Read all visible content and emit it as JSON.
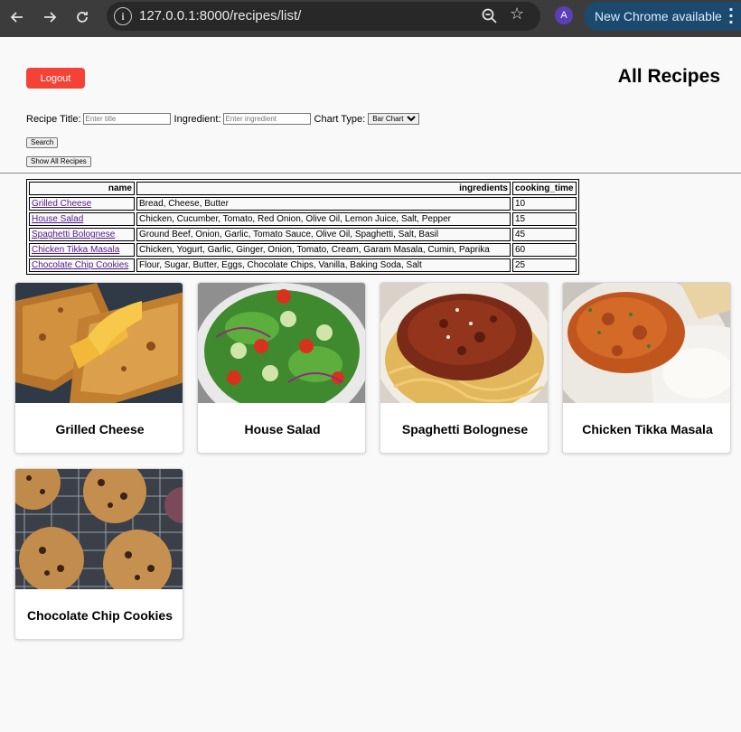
{
  "browser": {
    "url": "127.0.0.1:8000/recipes/list/",
    "profile_initial": "A",
    "update_label": "New Chrome available",
    "icons": [
      "back-arrow-icon",
      "forward-arrow-icon",
      "reload-icon",
      "site-info-icon",
      "zoom-icon",
      "bookmark-star-icon",
      "more-vert-icon"
    ]
  },
  "header": {
    "logout_label": "Logout",
    "title": "All Recipes"
  },
  "search": {
    "title_label": "Recipe Title:",
    "title_placeholder": "Enter title",
    "ingredient_label": "Ingredient:",
    "ingredient_placeholder": "Enter ingredient",
    "chart_label": "Chart Type:",
    "chart_selected": "Bar Chart",
    "search_label": "Search",
    "show_all_label": "Show All Recipes"
  },
  "table": {
    "columns": [
      "name",
      "ingredients",
      "cooking_time"
    ],
    "rows": [
      {
        "name": "Grilled Cheese",
        "ingredients": "Bread, Cheese, Butter",
        "cooking_time": "10"
      },
      {
        "name": "House Salad",
        "ingredients": "Chicken, Cucumber, Tomato, Red Onion, Olive Oil, Lemon Juice, Salt, Pepper",
        "cooking_time": "15"
      },
      {
        "name": "Spaghetti Bolognese",
        "ingredients": "Ground Beef, Onion, Garlic, Tomato Sauce, Olive Oil, Spaghetti, Salt, Basil",
        "cooking_time": "45"
      },
      {
        "name": "Chicken Tikka Masala",
        "ingredients": "Chicken, Yogurt, Garlic, Ginger, Onion, Tomato, Cream, Garam Masala, Cumin, Paprika",
        "cooking_time": "60"
      },
      {
        "name": "Chocolate Chip Cookies",
        "ingredients": "Flour, Sugar, Butter, Eggs, Chocolate Chips, Vanilla, Baking Soda, Salt",
        "cooking_time": "25"
      }
    ]
  },
  "cards": [
    {
      "title": "Grilled Cheese"
    },
    {
      "title": "House Salad"
    },
    {
      "title": "Spaghetti Bolognese"
    },
    {
      "title": "Chicken Tikka Masala"
    },
    {
      "title": "Chocolate Chip Cookies"
    }
  ],
  "colors": {
    "logout_bg": "#f44336",
    "link": "#551a8b",
    "page_bg": "#f9f9f9",
    "chrome_bg": "#3c3c3c",
    "update_pill": "#1c4a6e"
  }
}
